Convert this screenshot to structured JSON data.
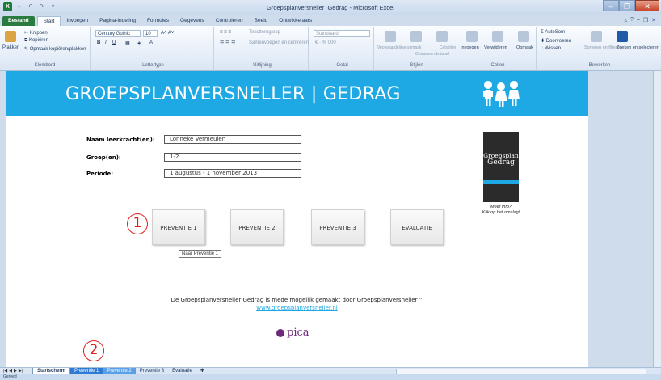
{
  "window": {
    "title": "Groepsplanversneller_Gedrag - Microsoft Excel",
    "app_logo": "X"
  },
  "ribbon_tabs": [
    "Bestand",
    "Start",
    "Invoegen",
    "Pagina-indeling",
    "Formules",
    "Gegevens",
    "Controleren",
    "Beeld",
    "Ontwikkelaars"
  ],
  "ribbon": {
    "clipboard": {
      "label": "Klembord",
      "paste": "Plakken",
      "cut": "Knippen",
      "copy": "Kopiëren",
      "format_painter": "Opmaak kopiëren/plakken"
    },
    "font": {
      "label": "Lettertype",
      "font_name": "Century Gothic",
      "font_size": "10"
    },
    "alignment": {
      "label": "Uitlijning",
      "wrap_text": "Tekstterugloop",
      "merge_center": "Samenvoegen en centreren"
    },
    "number": {
      "label": "Getal",
      "format": "Standaard"
    },
    "styles": {
      "label": "Stijlen",
      "conditional": "Voorwaardelijke opmaak",
      "as_table": "Opmaken als tabel",
      "cell_styles": "Celstijlen"
    },
    "cells": {
      "label": "Cellen",
      "insert": "Invoegen",
      "delete": "Verwijderen",
      "format": "Opmaak"
    },
    "editing": {
      "label": "Bewerken",
      "autosum": "AutoSom",
      "fill": "Doorvoeren",
      "clear": "Wissen",
      "sort": "Sorteren en filteren",
      "find": "Zoeken en selecteren"
    }
  },
  "banner": {
    "title": "GROEPSPLANVERSNELLER | GEDRAG"
  },
  "form": {
    "teacher_label": "Naam leerkracht(en):",
    "teacher_value": "Lonneke Vermeulen",
    "group_label": "Groep(en):",
    "group_value": "1-2",
    "period_label": "Periode:",
    "period_value": "1 augustus - 1 november 2013"
  },
  "book": {
    "title_line1": "Groepsplan",
    "title_line2": "Gedrag",
    "caption_line1": "Meer info?",
    "caption_line2": "Klik op het omslag!"
  },
  "nav_buttons": [
    "PREVENTIE 1",
    "PREVENTIE 2",
    "PREVENTIE 3",
    "EVALUATIE"
  ],
  "tooltip": "Naar Preventie 1",
  "markers": [
    "1",
    "2"
  ],
  "credit": {
    "text": "De Groepsplanversneller Gedrag is mede mogelijk gemaakt door Groepsplanversneller™",
    "link": "www.groepsplanversneller.nl"
  },
  "logo_text": "pica",
  "sheet_tabs": [
    "Startscherm",
    "Preventie 1",
    "Preventie 2",
    "Preventie 3",
    "Evaluatie"
  ],
  "status": "Gereed"
}
